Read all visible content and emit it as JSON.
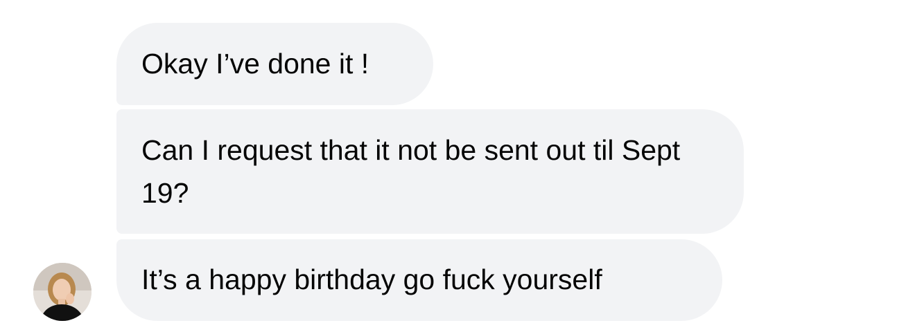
{
  "conversation": {
    "messages": [
      {
        "text": "Okay I’ve done it !"
      },
      {
        "text": "Can I request that it not be sent out til Sept 19?"
      },
      {
        "text": "It’s a happy birthday go fuck yourself"
      }
    ],
    "sender": {
      "avatar_icon": "person-photo-avatar"
    },
    "colors": {
      "bubble_background": "#f2f3f5",
      "text": "#050505",
      "page_background": "#ffffff"
    }
  }
}
